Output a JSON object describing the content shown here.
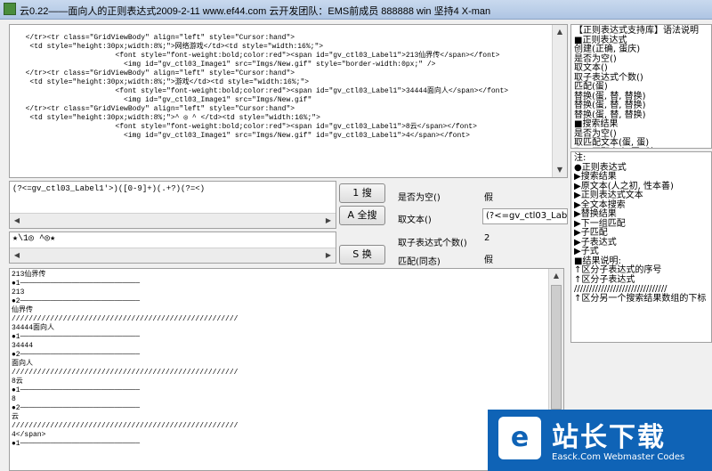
{
  "window": {
    "title": "云0.22——面向人的正则表达式2009-2-11     www.ef44.com 云开发团队：EMS前成员 888888  win 坚持4 X-man"
  },
  "source": {
    "lines": [
      "  </tr><tr class=\"GridViewBody\" align=\"left\" style=\"Cursor:hand\">",
      "   <td style=\"height:30px;width:8%;\">网络游戏</td><td style=\"width:16%;\">",
      "                       <font style=\"font-weight:bold;color:red\"><span id=\"gv_ctl03_Label1\">213仙界传</span></font>",
      "                         <img id=\"gv_ctl03_Image1\" src=\"Imgs/New.gif\" style=\"border-width:0px;\" />",
      "",
      "  </tr><tr class=\"GridViewBody\" align=\"left\" style=\"Cursor:hand\">",
      "   <td style=\"height:30px;width:8%;\">游戏</td><td style=\"width:16%;\">",
      "                       <font style=\"font-weight:bold;color:red\"><span id=\"gv_ctl03_Label1\">34444面向人</span></font>",
      "                         <img id=\"gv_ctl03_Image1\" src=\"Imgs/New.gif\"",
      "  </tr><tr class=\"GridViewBody\" align=\"left\" style=\"Cursor:hand\">",
      "   <td style=\"height:30px;width:8%;\">^ ◎ ^ </td><td style=\"width:16%;\">",
      "                       <font style=\"font-weight:bold;color:red\"><span id=\"gv_ctl03_Label1\">8云</span></font>",
      "                         <img id=\"gv_ctl03_Image1\" src=\"Imgs/New.gif\" id=\"gv_ctl03_Label1\">4</span></font>"
    ]
  },
  "regex": {
    "pattern": "(?<=gv_ctl03_Label1'>)([0-9]+)(.+?)(?=<)",
    "replace": "★\\1◎ ^◎★"
  },
  "buttons": {
    "search": "搜",
    "search_key": "1",
    "search_all": "全搜",
    "search_all_key": "A",
    "replace": "换",
    "replace_key": "S"
  },
  "options": {
    "is_empty_label": "是否为空()",
    "is_empty_value": "假",
    "get_text_label": "取文本()",
    "get_text_value": "(?<=gv_ctl03_Label1",
    "group_count_label": "取子表达式个数()",
    "group_count_value": "2",
    "match_label": "匹配(同态)",
    "match_value": "假"
  },
  "results": {
    "lines": [
      "213仙界传",
      "●1────────────────────────────",
      "213",
      "●2────────────────────────────",
      "仙界传",
      "/////////////////////////////////////////////////////",
      "34444面向人",
      "●1────────────────────────────",
      "34444",
      "●2────────────────────────────",
      "面向人",
      "/////////////////////////////////////////////////////",
      "8云",
      "●1────────────────────────────",
      "8",
      "●2────────────────────────────",
      "云",
      "/////////////////////////////////////////////////////",
      "4</span>",
      "●1────────────────────────────"
    ]
  },
  "help": {
    "top_lines": [
      "【正则表达式支持库】语法说明",
      "■正则表达式",
      "  创建(正确, 蛋庆)",
      "  是否为空()",
      "  取文本()",
      "  取子表达式个数()",
      "  匹配(蛋)",
      "  替换(蛋, 替, 替换)",
      "  替换(蛋, 替, 替换)",
      "  替换(蛋, 替, 替换)",
      "■搜索结果",
      "  是否为空()",
      "  取匹配文本(蛋, 蛋)",
      "  取子匹配文本(蛋, 替)"
    ],
    "notes_lines": [
      "注:",
      "●正则表达式",
      "  ▶搜索结果",
      "  ▶原文本(人之初, 性本善)",
      "  ▶正则表达式文本",
      "  ▶全文本搜索",
      "  ▶替换结果",
      "  ▶下一组匹配",
      "  ▶子匹配",
      "  ▶子表达式",
      "  ▶子式",
      "■结果说明:",
      "↑区分子表达式的序号",
      "",
      "↑区分子表达式",
      "///////////////////////////////",
      "↑区分另一个搜索结果数组的下标"
    ]
  },
  "watermark": {
    "name": "站长下载",
    "url": "Easck.Com Webmaster Codes"
  }
}
